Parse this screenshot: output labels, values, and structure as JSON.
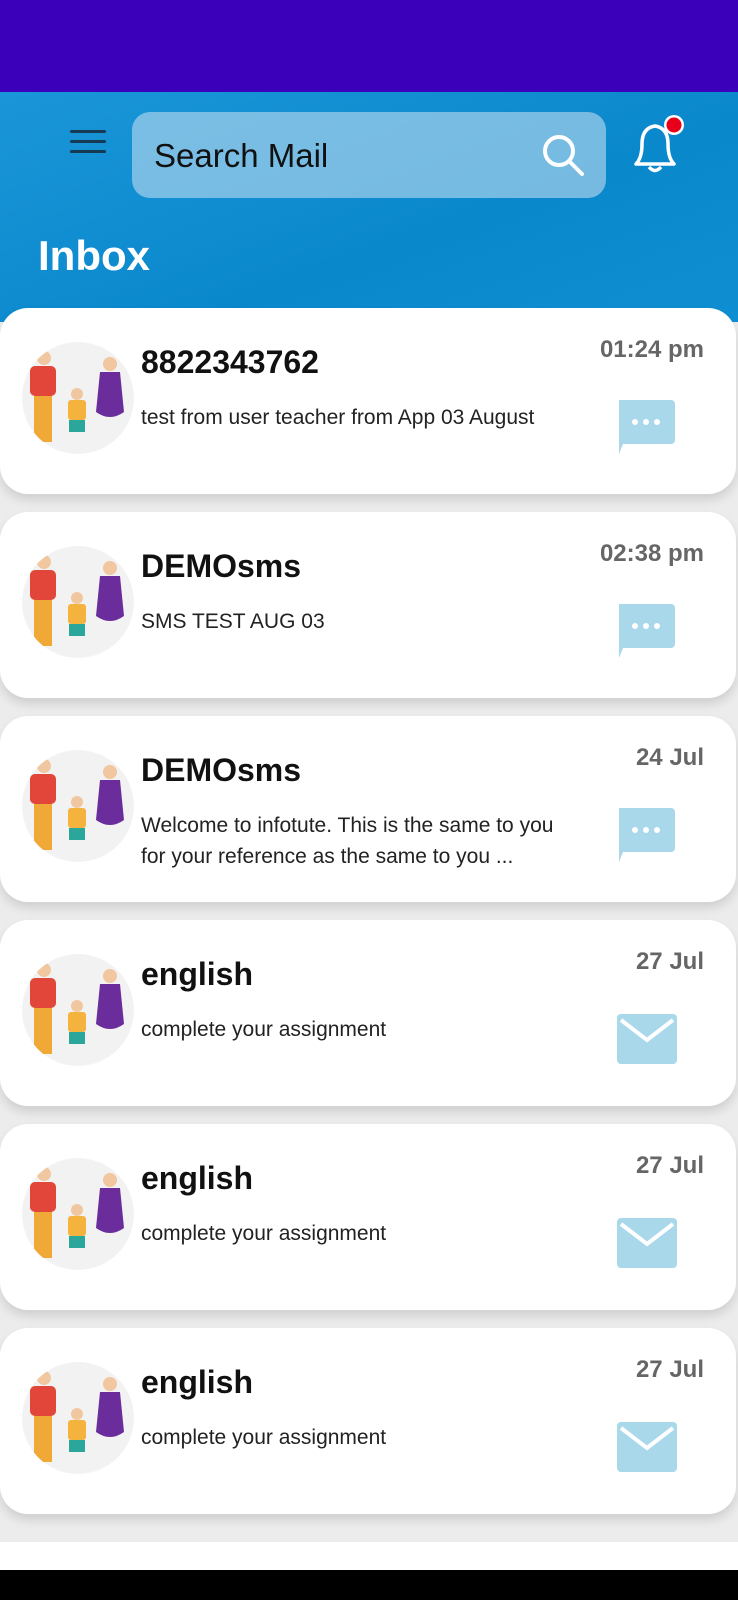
{
  "header": {
    "search_placeholder": "Search Mail",
    "title": "Inbox",
    "has_notification": true,
    "accent_color": "#0a88cc",
    "status_bar_color": "#3b00b9"
  },
  "messages": [
    {
      "sender": "8822343762",
      "preview": "test from user teacher from App 03 August",
      "time": "01:24 pm",
      "icon": "sms-bubble-icon"
    },
    {
      "sender": "DEMOsms",
      "preview": "SMS TEST AUG 03",
      "time": "02:38 pm",
      "icon": "sms-bubble-icon"
    },
    {
      "sender": "DEMOsms",
      "preview": "Welcome to infotute. This is the same to you for your reference as the same to you ...",
      "time": "24 Jul",
      "icon": "sms-bubble-icon"
    },
    {
      "sender": "english",
      "preview": "complete your assignment",
      "time": "27 Jul",
      "icon": "mail-envelope-icon"
    },
    {
      "sender": "english",
      "preview": "complete your assignment",
      "time": "27 Jul",
      "icon": "mail-envelope-icon"
    },
    {
      "sender": "english",
      "preview": "complete your assignment",
      "time": "27 Jul",
      "icon": "mail-envelope-icon"
    }
  ]
}
